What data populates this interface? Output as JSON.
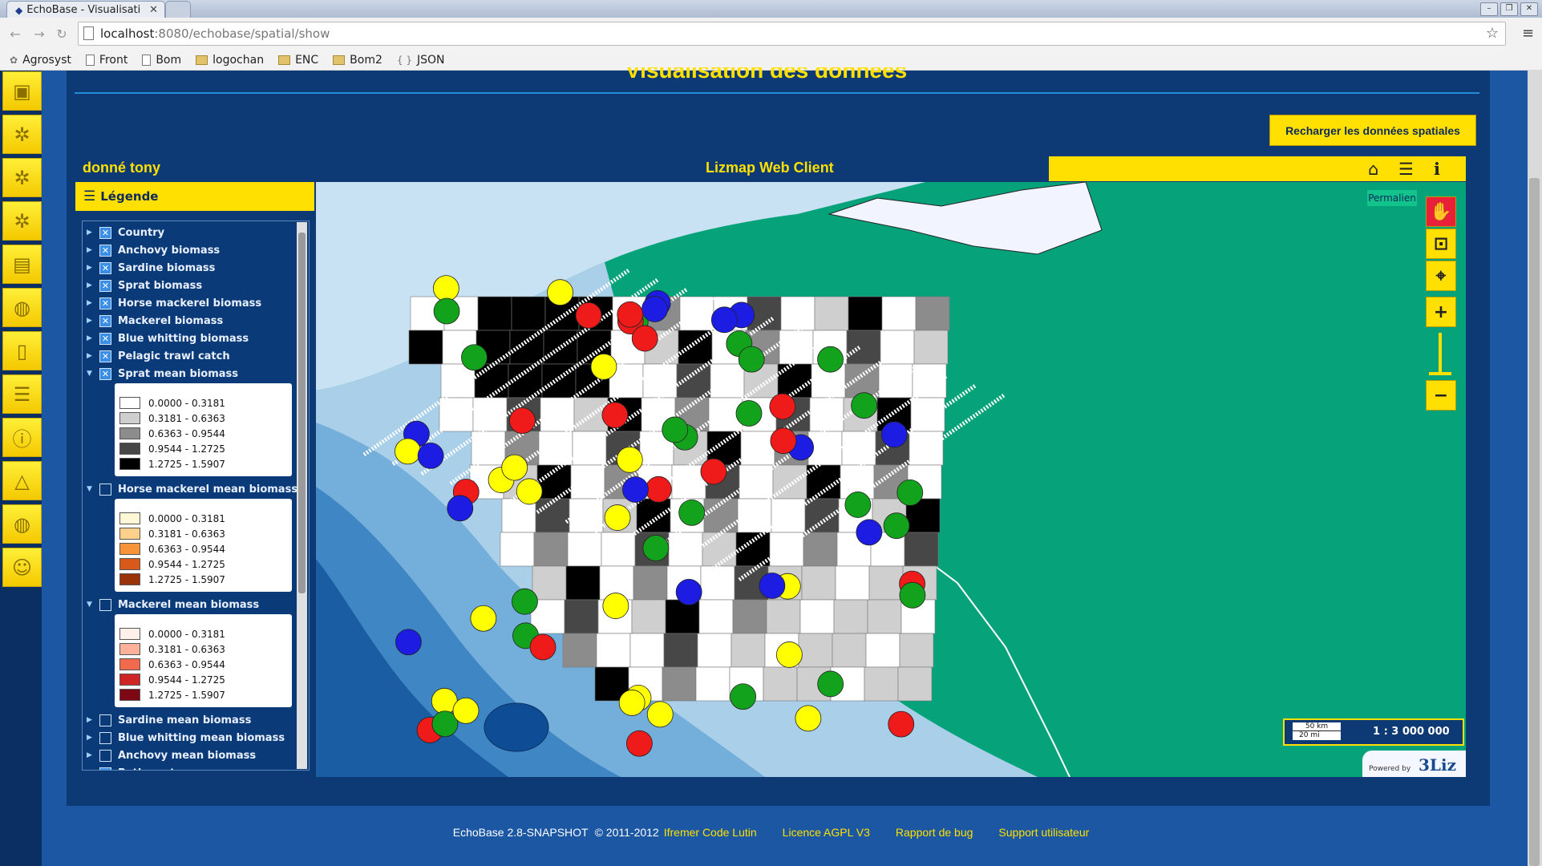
{
  "browser": {
    "tab_title": "EchoBase - Visualisati",
    "url_host": "localhost",
    "url_path": ":8080/echobase/spatial/show",
    "bookmarks": [
      "Agrosyst",
      "Front",
      "Bom",
      "logochan",
      "ENC",
      "Bom2",
      "JSON"
    ]
  },
  "page": {
    "title": "Visualisation des données",
    "reload_button": "Recharger les données spatiales",
    "project_name": "donné tony",
    "lizmap_title": "Lizmap Web Client",
    "permalink": "Permalien",
    "scale": "1 : 3 000 000",
    "scale_km": "50 km",
    "scale_mi": "20 mi",
    "powered_by": "Powered by",
    "powered_logo": "3Liz"
  },
  "legend": {
    "header": "Légende",
    "layers": [
      {
        "name": "Country",
        "checked": true,
        "expanded": false
      },
      {
        "name": "Anchovy biomass",
        "checked": true,
        "expanded": false
      },
      {
        "name": "Sardine biomass",
        "checked": true,
        "expanded": false
      },
      {
        "name": "Sprat biomass",
        "checked": true,
        "expanded": false
      },
      {
        "name": "Horse mackerel biomass",
        "checked": true,
        "expanded": false
      },
      {
        "name": "Mackerel biomass",
        "checked": true,
        "expanded": false
      },
      {
        "name": "Blue whitting biomass",
        "checked": true,
        "expanded": false
      },
      {
        "name": "Pelagic trawl catch",
        "checked": true,
        "expanded": false
      },
      {
        "name": "Sprat mean biomass",
        "checked": true,
        "expanded": true
      },
      {
        "name": "Horse mackerel mean biomass",
        "checked": false,
        "expanded": true
      },
      {
        "name": "Mackerel mean biomass",
        "checked": false,
        "expanded": true
      },
      {
        "name": "Sardine mean biomass",
        "checked": false,
        "expanded": false
      },
      {
        "name": "Blue whitting mean biomass",
        "checked": false,
        "expanded": false
      },
      {
        "name": "Anchovy mean biomass",
        "checked": false,
        "expanded": false
      },
      {
        "name": "Bathymetry",
        "checked": true,
        "expanded": true
      }
    ],
    "classes": [
      "0.0000 - 0.3181",
      "0.3181 - 0.6363",
      "0.6363 - 0.9544",
      "0.9544 - 1.2725",
      "1.2725 - 1.5907"
    ],
    "ramps": {
      "sprat": [
        "#ffffff",
        "#cfcfcf",
        "#8c8c8c",
        "#474747",
        "#000000"
      ],
      "horse": [
        "#fff8d6",
        "#fdd18b",
        "#f7943a",
        "#d9591a",
        "#99340a"
      ],
      "mackerel": [
        "#fff0ea",
        "#fbb19a",
        "#f26a4e",
        "#cf2525",
        "#7d0712"
      ]
    }
  },
  "footer": {
    "product": "EchoBase 2.8-SNAPSHOT",
    "copyright": "© 2011-2012",
    "org": "Ifremer Code Lutin",
    "licence": "Licence AGPL V3",
    "bug": "Rapport de bug",
    "support": "Support utilisateur"
  }
}
